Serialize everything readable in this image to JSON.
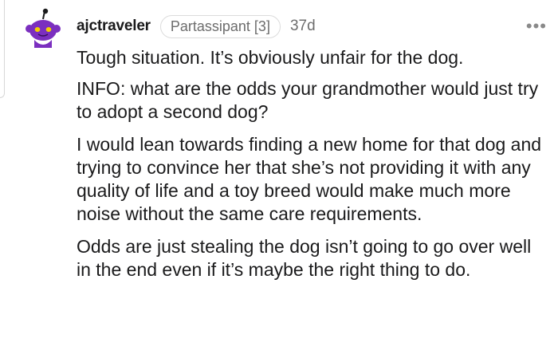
{
  "comment": {
    "username": "ajctraveler",
    "flair": "Partassipant [3]",
    "age": "37d",
    "more_label": "•••",
    "avatar_icon": "snoo-avatar-icon",
    "paragraphs": [
      "Tough situation. It’s obviously unfair for the dog.",
      "INFO: what are the odds your grandmother would just try to adopt a second dog?",
      "I would lean towards finding a new home for that dog and trying to convince her that she’s not providing it with any quality of life and a toy breed would make much more noise without the same care requirements.",
      "Odds are just stealing the dog isn’t going to go over well in the end even if it’s maybe the right thing to do."
    ]
  },
  "colors": {
    "avatar_purple": "#7b2fbf",
    "avatar_yellow": "#f5d000",
    "meta_gray": "#6d6d6d"
  }
}
